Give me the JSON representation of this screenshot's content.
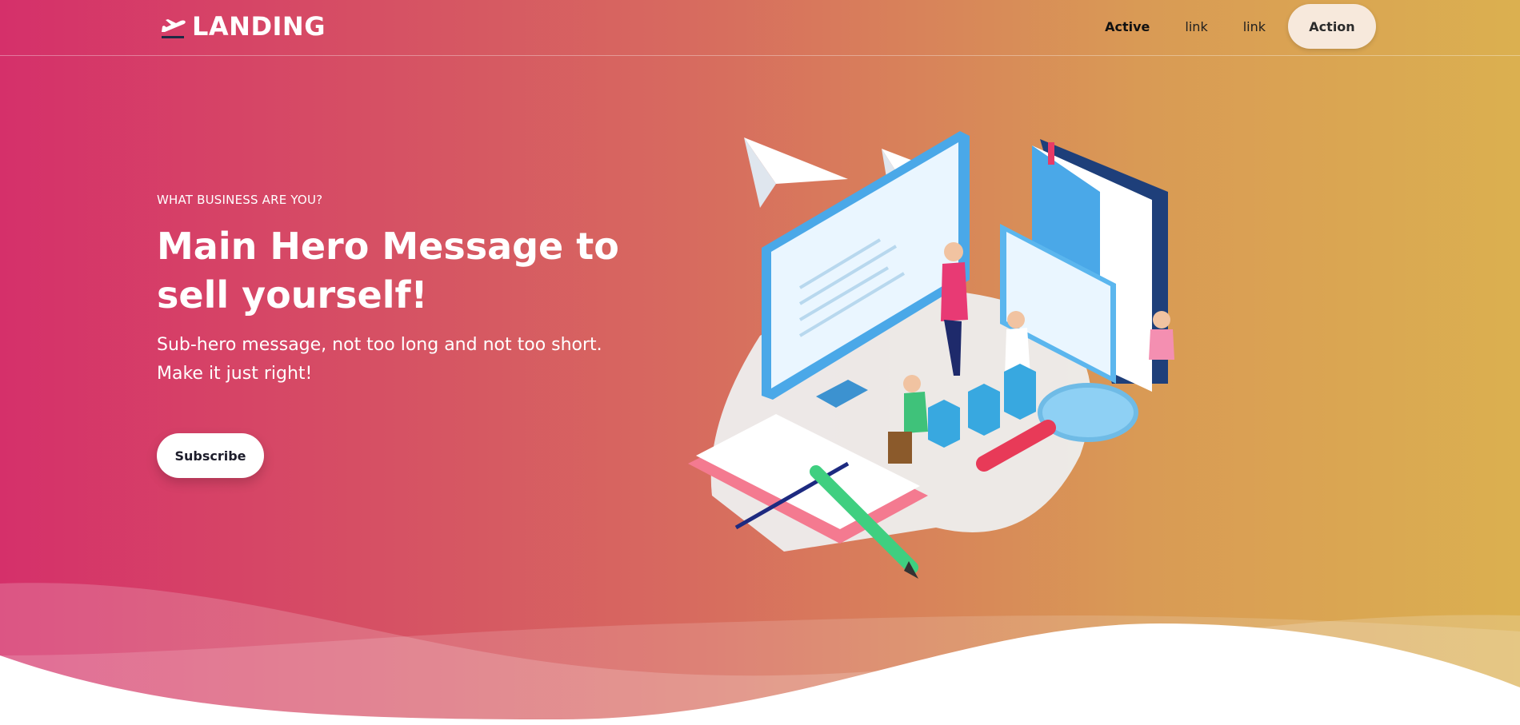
{
  "nav": {
    "logo_text": "LANDING",
    "logo_icon": "plane-departure-icon",
    "links": [
      {
        "label": "Active",
        "active": true
      },
      {
        "label": "link",
        "active": false
      },
      {
        "label": "link",
        "active": false
      }
    ],
    "action_label": "Action"
  },
  "hero": {
    "eyebrow": "WHAT BUSINESS ARE YOU?",
    "headline": "Main Hero Message to sell yourself!",
    "subheadline": "Sub-hero message, not too long and not too short. Make it just right!",
    "cta_label": "Subscribe"
  },
  "colors": {
    "gradient_start": "#d5306a",
    "gradient_end": "#dbb050",
    "action_bg": "#f7e9dc",
    "text_light": "#ffffff"
  }
}
